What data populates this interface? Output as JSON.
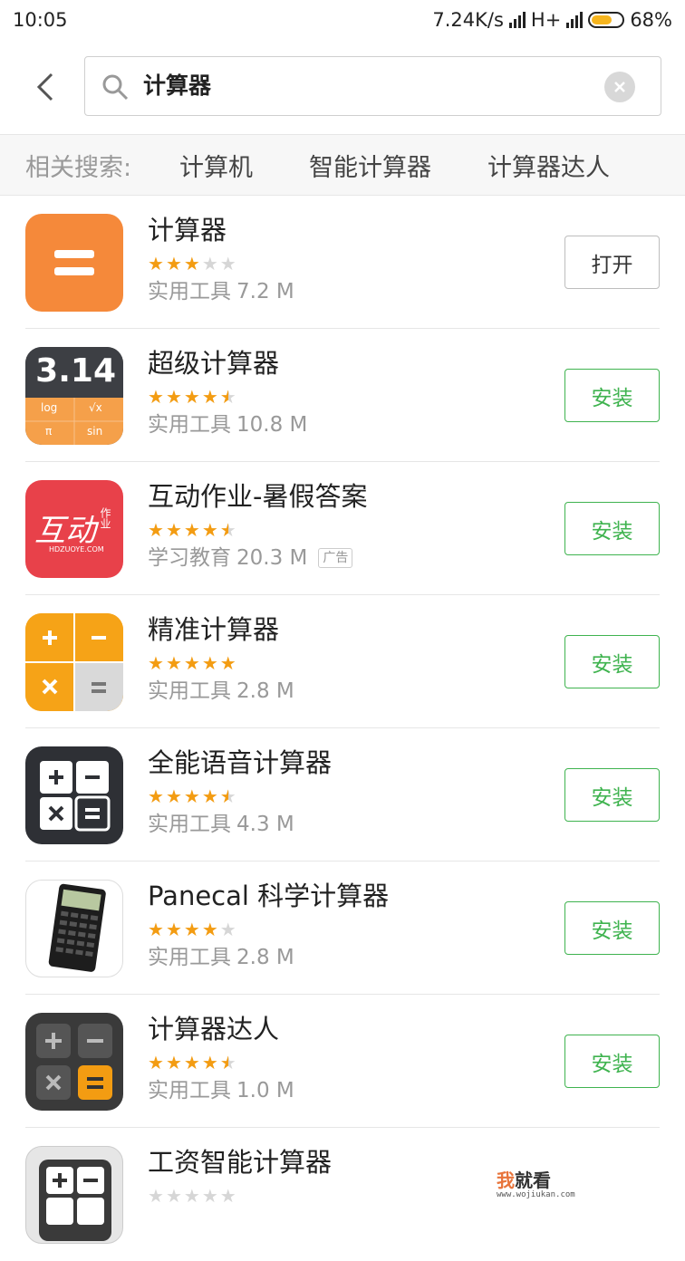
{
  "status_bar": {
    "time": "10:05",
    "net_speed": "7.24K/s",
    "network_type": "H+",
    "battery_percent": "68%",
    "battery_level": 0.68
  },
  "search": {
    "query": "计算器",
    "icons": {
      "back": "back-arrow-icon",
      "search": "search-icon",
      "clear": "clear-icon"
    }
  },
  "related": {
    "label": "相关搜索:",
    "items": [
      "计算机",
      "智能计算器",
      "计算器达人"
    ]
  },
  "colors": {
    "accent": "#3fb34f",
    "star": "#f39c12",
    "star_off": "#d6d6d6"
  },
  "apps": [
    {
      "name": "计算器",
      "rating": 3,
      "category": "实用工具",
      "size": "7.2 M",
      "button": "打开",
      "action": "open"
    },
    {
      "name": "超级计算器",
      "rating": 4.5,
      "category": "实用工具",
      "size": "10.8 M",
      "button": "安装",
      "action": "install"
    },
    {
      "name": "互动作业-暑假答案",
      "rating": 4.5,
      "category": "学习教育",
      "size": "20.3 M",
      "ad": "广告",
      "button": "安装",
      "action": "install"
    },
    {
      "name": "精准计算器",
      "rating": 5,
      "category": "实用工具",
      "size": "2.8 M",
      "button": "安装",
      "action": "install"
    },
    {
      "name": "全能语音计算器",
      "rating": 4.5,
      "category": "实用工具",
      "size": "4.3 M",
      "button": "安装",
      "action": "install"
    },
    {
      "name": "Panecal 科学计算器",
      "rating": 4,
      "category": "实用工具",
      "size": "2.8 M",
      "button": "安装",
      "action": "install"
    },
    {
      "name": "计算器达人",
      "rating": 4.5,
      "category": "实用工具",
      "size": "1.0 M",
      "button": "安装",
      "action": "install"
    },
    {
      "name": "工资智能计算器",
      "rating": 0,
      "category": "",
      "size": "",
      "button": "",
      "action": "install"
    }
  ],
  "icon_text": {
    "super_calc_value": "3.14",
    "super_calc_keys": [
      "log",
      "√x",
      "π",
      "sin"
    ],
    "hudong_logo": "互动",
    "hudong_sub": "作业",
    "hudong_url": "HDZUOYE.COM"
  },
  "watermark": {
    "brand_a": "我",
    "brand_b": "就看",
    "url": "www.wojiukan.com"
  }
}
